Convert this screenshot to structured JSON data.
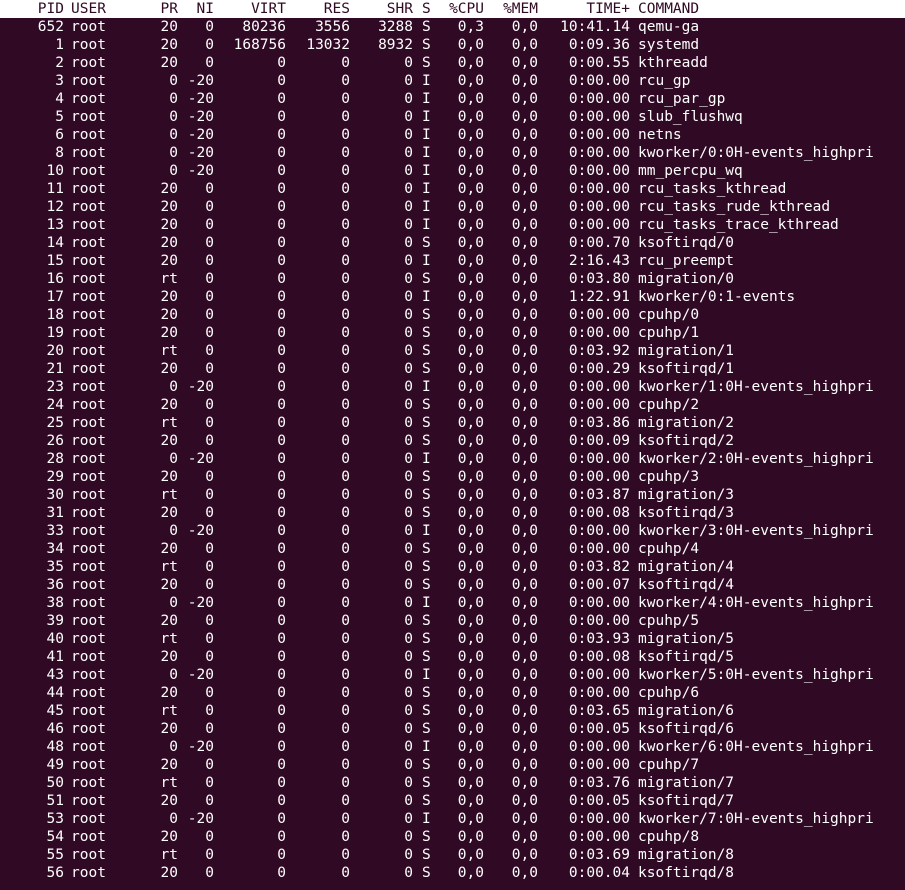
{
  "header": {
    "pid": "PID",
    "user": "USER",
    "pr": "PR",
    "ni": "NI",
    "virt": "VIRT",
    "res": "RES",
    "shr": "SHR",
    "s": "S",
    "cpu": "%CPU",
    "mem": "%MEM",
    "time": "TIME+",
    "command": "COMMAND"
  },
  "colors": {
    "background": "#300a24",
    "foreground": "#ffffff",
    "header_background": "#ffffff",
    "header_text": "#300a24"
  },
  "processes": [
    {
      "pid": "652",
      "user": "root",
      "pr": "20",
      "ni": "0",
      "virt": "80236",
      "res": "3556",
      "shr": "3288",
      "s": "S",
      "cpu": "0,3",
      "mem": "0,0",
      "time": "10:41.14",
      "command": "qemu-ga"
    },
    {
      "pid": "1",
      "user": "root",
      "pr": "20",
      "ni": "0",
      "virt": "168756",
      "res": "13032",
      "shr": "8932",
      "s": "S",
      "cpu": "0,0",
      "mem": "0,0",
      "time": "0:09.36",
      "command": "systemd"
    },
    {
      "pid": "2",
      "user": "root",
      "pr": "20",
      "ni": "0",
      "virt": "0",
      "res": "0",
      "shr": "0",
      "s": "S",
      "cpu": "0,0",
      "mem": "0,0",
      "time": "0:00.55",
      "command": "kthreadd"
    },
    {
      "pid": "3",
      "user": "root",
      "pr": "0",
      "ni": "-20",
      "virt": "0",
      "res": "0",
      "shr": "0",
      "s": "I",
      "cpu": "0,0",
      "mem": "0,0",
      "time": "0:00.00",
      "command": "rcu_gp"
    },
    {
      "pid": "4",
      "user": "root",
      "pr": "0",
      "ni": "-20",
      "virt": "0",
      "res": "0",
      "shr": "0",
      "s": "I",
      "cpu": "0,0",
      "mem": "0,0",
      "time": "0:00.00",
      "command": "rcu_par_gp"
    },
    {
      "pid": "5",
      "user": "root",
      "pr": "0",
      "ni": "-20",
      "virt": "0",
      "res": "0",
      "shr": "0",
      "s": "I",
      "cpu": "0,0",
      "mem": "0,0",
      "time": "0:00.00",
      "command": "slub_flushwq"
    },
    {
      "pid": "6",
      "user": "root",
      "pr": "0",
      "ni": "-20",
      "virt": "0",
      "res": "0",
      "shr": "0",
      "s": "I",
      "cpu": "0,0",
      "mem": "0,0",
      "time": "0:00.00",
      "command": "netns"
    },
    {
      "pid": "8",
      "user": "root",
      "pr": "0",
      "ni": "-20",
      "virt": "0",
      "res": "0",
      "shr": "0",
      "s": "I",
      "cpu": "0,0",
      "mem": "0,0",
      "time": "0:00.00",
      "command": "kworker/0:0H-events_highpri"
    },
    {
      "pid": "10",
      "user": "root",
      "pr": "0",
      "ni": "-20",
      "virt": "0",
      "res": "0",
      "shr": "0",
      "s": "I",
      "cpu": "0,0",
      "mem": "0,0",
      "time": "0:00.00",
      "command": "mm_percpu_wq"
    },
    {
      "pid": "11",
      "user": "root",
      "pr": "20",
      "ni": "0",
      "virt": "0",
      "res": "0",
      "shr": "0",
      "s": "I",
      "cpu": "0,0",
      "mem": "0,0",
      "time": "0:00.00",
      "command": "rcu_tasks_kthread"
    },
    {
      "pid": "12",
      "user": "root",
      "pr": "20",
      "ni": "0",
      "virt": "0",
      "res": "0",
      "shr": "0",
      "s": "I",
      "cpu": "0,0",
      "mem": "0,0",
      "time": "0:00.00",
      "command": "rcu_tasks_rude_kthread"
    },
    {
      "pid": "13",
      "user": "root",
      "pr": "20",
      "ni": "0",
      "virt": "0",
      "res": "0",
      "shr": "0",
      "s": "I",
      "cpu": "0,0",
      "mem": "0,0",
      "time": "0:00.00",
      "command": "rcu_tasks_trace_kthread"
    },
    {
      "pid": "14",
      "user": "root",
      "pr": "20",
      "ni": "0",
      "virt": "0",
      "res": "0",
      "shr": "0",
      "s": "S",
      "cpu": "0,0",
      "mem": "0,0",
      "time": "0:00.70",
      "command": "ksoftirqd/0"
    },
    {
      "pid": "15",
      "user": "root",
      "pr": "20",
      "ni": "0",
      "virt": "0",
      "res": "0",
      "shr": "0",
      "s": "I",
      "cpu": "0,0",
      "mem": "0,0",
      "time": "2:16.43",
      "command": "rcu_preempt"
    },
    {
      "pid": "16",
      "user": "root",
      "pr": "rt",
      "ni": "0",
      "virt": "0",
      "res": "0",
      "shr": "0",
      "s": "S",
      "cpu": "0,0",
      "mem": "0,0",
      "time": "0:03.80",
      "command": "migration/0"
    },
    {
      "pid": "17",
      "user": "root",
      "pr": "20",
      "ni": "0",
      "virt": "0",
      "res": "0",
      "shr": "0",
      "s": "I",
      "cpu": "0,0",
      "mem": "0,0",
      "time": "1:22.91",
      "command": "kworker/0:1-events"
    },
    {
      "pid": "18",
      "user": "root",
      "pr": "20",
      "ni": "0",
      "virt": "0",
      "res": "0",
      "shr": "0",
      "s": "S",
      "cpu": "0,0",
      "mem": "0,0",
      "time": "0:00.00",
      "command": "cpuhp/0"
    },
    {
      "pid": "19",
      "user": "root",
      "pr": "20",
      "ni": "0",
      "virt": "0",
      "res": "0",
      "shr": "0",
      "s": "S",
      "cpu": "0,0",
      "mem": "0,0",
      "time": "0:00.00",
      "command": "cpuhp/1"
    },
    {
      "pid": "20",
      "user": "root",
      "pr": "rt",
      "ni": "0",
      "virt": "0",
      "res": "0",
      "shr": "0",
      "s": "S",
      "cpu": "0,0",
      "mem": "0,0",
      "time": "0:03.92",
      "command": "migration/1"
    },
    {
      "pid": "21",
      "user": "root",
      "pr": "20",
      "ni": "0",
      "virt": "0",
      "res": "0",
      "shr": "0",
      "s": "S",
      "cpu": "0,0",
      "mem": "0,0",
      "time": "0:00.29",
      "command": "ksoftirqd/1"
    },
    {
      "pid": "23",
      "user": "root",
      "pr": "0",
      "ni": "-20",
      "virt": "0",
      "res": "0",
      "shr": "0",
      "s": "I",
      "cpu": "0,0",
      "mem": "0,0",
      "time": "0:00.00",
      "command": "kworker/1:0H-events_highpri"
    },
    {
      "pid": "24",
      "user": "root",
      "pr": "20",
      "ni": "0",
      "virt": "0",
      "res": "0",
      "shr": "0",
      "s": "S",
      "cpu": "0,0",
      "mem": "0,0",
      "time": "0:00.00",
      "command": "cpuhp/2"
    },
    {
      "pid": "25",
      "user": "root",
      "pr": "rt",
      "ni": "0",
      "virt": "0",
      "res": "0",
      "shr": "0",
      "s": "S",
      "cpu": "0,0",
      "mem": "0,0",
      "time": "0:03.86",
      "command": "migration/2"
    },
    {
      "pid": "26",
      "user": "root",
      "pr": "20",
      "ni": "0",
      "virt": "0",
      "res": "0",
      "shr": "0",
      "s": "S",
      "cpu": "0,0",
      "mem": "0,0",
      "time": "0:00.09",
      "command": "ksoftirqd/2"
    },
    {
      "pid": "28",
      "user": "root",
      "pr": "0",
      "ni": "-20",
      "virt": "0",
      "res": "0",
      "shr": "0",
      "s": "I",
      "cpu": "0,0",
      "mem": "0,0",
      "time": "0:00.00",
      "command": "kworker/2:0H-events_highpri"
    },
    {
      "pid": "29",
      "user": "root",
      "pr": "20",
      "ni": "0",
      "virt": "0",
      "res": "0",
      "shr": "0",
      "s": "S",
      "cpu": "0,0",
      "mem": "0,0",
      "time": "0:00.00",
      "command": "cpuhp/3"
    },
    {
      "pid": "30",
      "user": "root",
      "pr": "rt",
      "ni": "0",
      "virt": "0",
      "res": "0",
      "shr": "0",
      "s": "S",
      "cpu": "0,0",
      "mem": "0,0",
      "time": "0:03.87",
      "command": "migration/3"
    },
    {
      "pid": "31",
      "user": "root",
      "pr": "20",
      "ni": "0",
      "virt": "0",
      "res": "0",
      "shr": "0",
      "s": "S",
      "cpu": "0,0",
      "mem": "0,0",
      "time": "0:00.08",
      "command": "ksoftirqd/3"
    },
    {
      "pid": "33",
      "user": "root",
      "pr": "0",
      "ni": "-20",
      "virt": "0",
      "res": "0",
      "shr": "0",
      "s": "I",
      "cpu": "0,0",
      "mem": "0,0",
      "time": "0:00.00",
      "command": "kworker/3:0H-events_highpri"
    },
    {
      "pid": "34",
      "user": "root",
      "pr": "20",
      "ni": "0",
      "virt": "0",
      "res": "0",
      "shr": "0",
      "s": "S",
      "cpu": "0,0",
      "mem": "0,0",
      "time": "0:00.00",
      "command": "cpuhp/4"
    },
    {
      "pid": "35",
      "user": "root",
      "pr": "rt",
      "ni": "0",
      "virt": "0",
      "res": "0",
      "shr": "0",
      "s": "S",
      "cpu": "0,0",
      "mem": "0,0",
      "time": "0:03.82",
      "command": "migration/4"
    },
    {
      "pid": "36",
      "user": "root",
      "pr": "20",
      "ni": "0",
      "virt": "0",
      "res": "0",
      "shr": "0",
      "s": "S",
      "cpu": "0,0",
      "mem": "0,0",
      "time": "0:00.07",
      "command": "ksoftirqd/4"
    },
    {
      "pid": "38",
      "user": "root",
      "pr": "0",
      "ni": "-20",
      "virt": "0",
      "res": "0",
      "shr": "0",
      "s": "I",
      "cpu": "0,0",
      "mem": "0,0",
      "time": "0:00.00",
      "command": "kworker/4:0H-events_highpri"
    },
    {
      "pid": "39",
      "user": "root",
      "pr": "20",
      "ni": "0",
      "virt": "0",
      "res": "0",
      "shr": "0",
      "s": "S",
      "cpu": "0,0",
      "mem": "0,0",
      "time": "0:00.00",
      "command": "cpuhp/5"
    },
    {
      "pid": "40",
      "user": "root",
      "pr": "rt",
      "ni": "0",
      "virt": "0",
      "res": "0",
      "shr": "0",
      "s": "S",
      "cpu": "0,0",
      "mem": "0,0",
      "time": "0:03.93",
      "command": "migration/5"
    },
    {
      "pid": "41",
      "user": "root",
      "pr": "20",
      "ni": "0",
      "virt": "0",
      "res": "0",
      "shr": "0",
      "s": "S",
      "cpu": "0,0",
      "mem": "0,0",
      "time": "0:00.08",
      "command": "ksoftirqd/5"
    },
    {
      "pid": "43",
      "user": "root",
      "pr": "0",
      "ni": "-20",
      "virt": "0",
      "res": "0",
      "shr": "0",
      "s": "I",
      "cpu": "0,0",
      "mem": "0,0",
      "time": "0:00.00",
      "command": "kworker/5:0H-events_highpri"
    },
    {
      "pid": "44",
      "user": "root",
      "pr": "20",
      "ni": "0",
      "virt": "0",
      "res": "0",
      "shr": "0",
      "s": "S",
      "cpu": "0,0",
      "mem": "0,0",
      "time": "0:00.00",
      "command": "cpuhp/6"
    },
    {
      "pid": "45",
      "user": "root",
      "pr": "rt",
      "ni": "0",
      "virt": "0",
      "res": "0",
      "shr": "0",
      "s": "S",
      "cpu": "0,0",
      "mem": "0,0",
      "time": "0:03.65",
      "command": "migration/6"
    },
    {
      "pid": "46",
      "user": "root",
      "pr": "20",
      "ni": "0",
      "virt": "0",
      "res": "0",
      "shr": "0",
      "s": "S",
      "cpu": "0,0",
      "mem": "0,0",
      "time": "0:00.05",
      "command": "ksoftirqd/6"
    },
    {
      "pid": "48",
      "user": "root",
      "pr": "0",
      "ni": "-20",
      "virt": "0",
      "res": "0",
      "shr": "0",
      "s": "I",
      "cpu": "0,0",
      "mem": "0,0",
      "time": "0:00.00",
      "command": "kworker/6:0H-events_highpri"
    },
    {
      "pid": "49",
      "user": "root",
      "pr": "20",
      "ni": "0",
      "virt": "0",
      "res": "0",
      "shr": "0",
      "s": "S",
      "cpu": "0,0",
      "mem": "0,0",
      "time": "0:00.00",
      "command": "cpuhp/7"
    },
    {
      "pid": "50",
      "user": "root",
      "pr": "rt",
      "ni": "0",
      "virt": "0",
      "res": "0",
      "shr": "0",
      "s": "S",
      "cpu": "0,0",
      "mem": "0,0",
      "time": "0:03.76",
      "command": "migration/7"
    },
    {
      "pid": "51",
      "user": "root",
      "pr": "20",
      "ni": "0",
      "virt": "0",
      "res": "0",
      "shr": "0",
      "s": "S",
      "cpu": "0,0",
      "mem": "0,0",
      "time": "0:00.05",
      "command": "ksoftirqd/7"
    },
    {
      "pid": "53",
      "user": "root",
      "pr": "0",
      "ni": "-20",
      "virt": "0",
      "res": "0",
      "shr": "0",
      "s": "I",
      "cpu": "0,0",
      "mem": "0,0",
      "time": "0:00.00",
      "command": "kworker/7:0H-events_highpri"
    },
    {
      "pid": "54",
      "user": "root",
      "pr": "20",
      "ni": "0",
      "virt": "0",
      "res": "0",
      "shr": "0",
      "s": "S",
      "cpu": "0,0",
      "mem": "0,0",
      "time": "0:00.00",
      "command": "cpuhp/8"
    },
    {
      "pid": "55",
      "user": "root",
      "pr": "rt",
      "ni": "0",
      "virt": "0",
      "res": "0",
      "shr": "0",
      "s": "S",
      "cpu": "0,0",
      "mem": "0,0",
      "time": "0:03.69",
      "command": "migration/8"
    },
    {
      "pid": "56",
      "user": "root",
      "pr": "20",
      "ni": "0",
      "virt": "0",
      "res": "0",
      "shr": "0",
      "s": "S",
      "cpu": "0,0",
      "mem": "0,0",
      "time": "0:00.04",
      "command": "ksoftirqd/8"
    }
  ]
}
